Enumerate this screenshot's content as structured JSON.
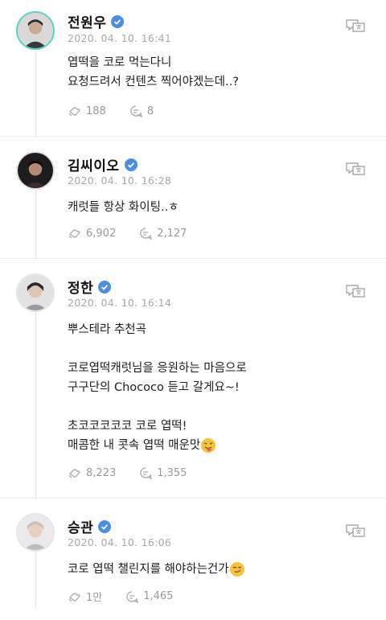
{
  "posts": [
    {
      "name": "전원우",
      "time": "2020. 04. 10. 16:41",
      "lines": [
        "엽떡을 코로 먹는다니",
        "요청드려서 컨텐츠 찍어야겠는데..?"
      ],
      "likes": "188",
      "comments": "8",
      "avatar_highlight": true
    },
    {
      "name": "김씨이오",
      "time": "2020. 04. 10. 16:28",
      "lines": [
        "캐럿들 항상 화이팅..ㅎ"
      ],
      "likes": "6,902",
      "comments": "2,127"
    },
    {
      "name": "정한",
      "time": "2020. 04. 10. 16:14",
      "lines": [
        "뿌스테라 추천곡",
        "",
        "코로엽떡캐럿님을 응원하는 마음으로",
        "구구단의 Chococo 듣고 갈게요~!",
        "",
        "초코코코코코 코로 엽떡!",
        "매콤한 내 콧속 엽떡 매운맛"
      ],
      "likes": "8,223",
      "comments": "1,355",
      "emoji": "tongue-out-emoji"
    },
    {
      "name": "승관",
      "time": "2020. 04. 10. 16:06",
      "lines": [
        "코로 엽떡 챌린지를 해야하는건가"
      ],
      "likes": "1만",
      "comments": "1,465",
      "emoji": "smirk-emoji"
    }
  ],
  "icons": {
    "verified": "verified-badge-icon",
    "translate": "translate-icon",
    "like": "like-icon",
    "comment": "comment-icon"
  },
  "colors": {
    "verified": "#4a90e2",
    "highlight_ring": "#5ad0c6",
    "meta": "#a8a8a8"
  }
}
